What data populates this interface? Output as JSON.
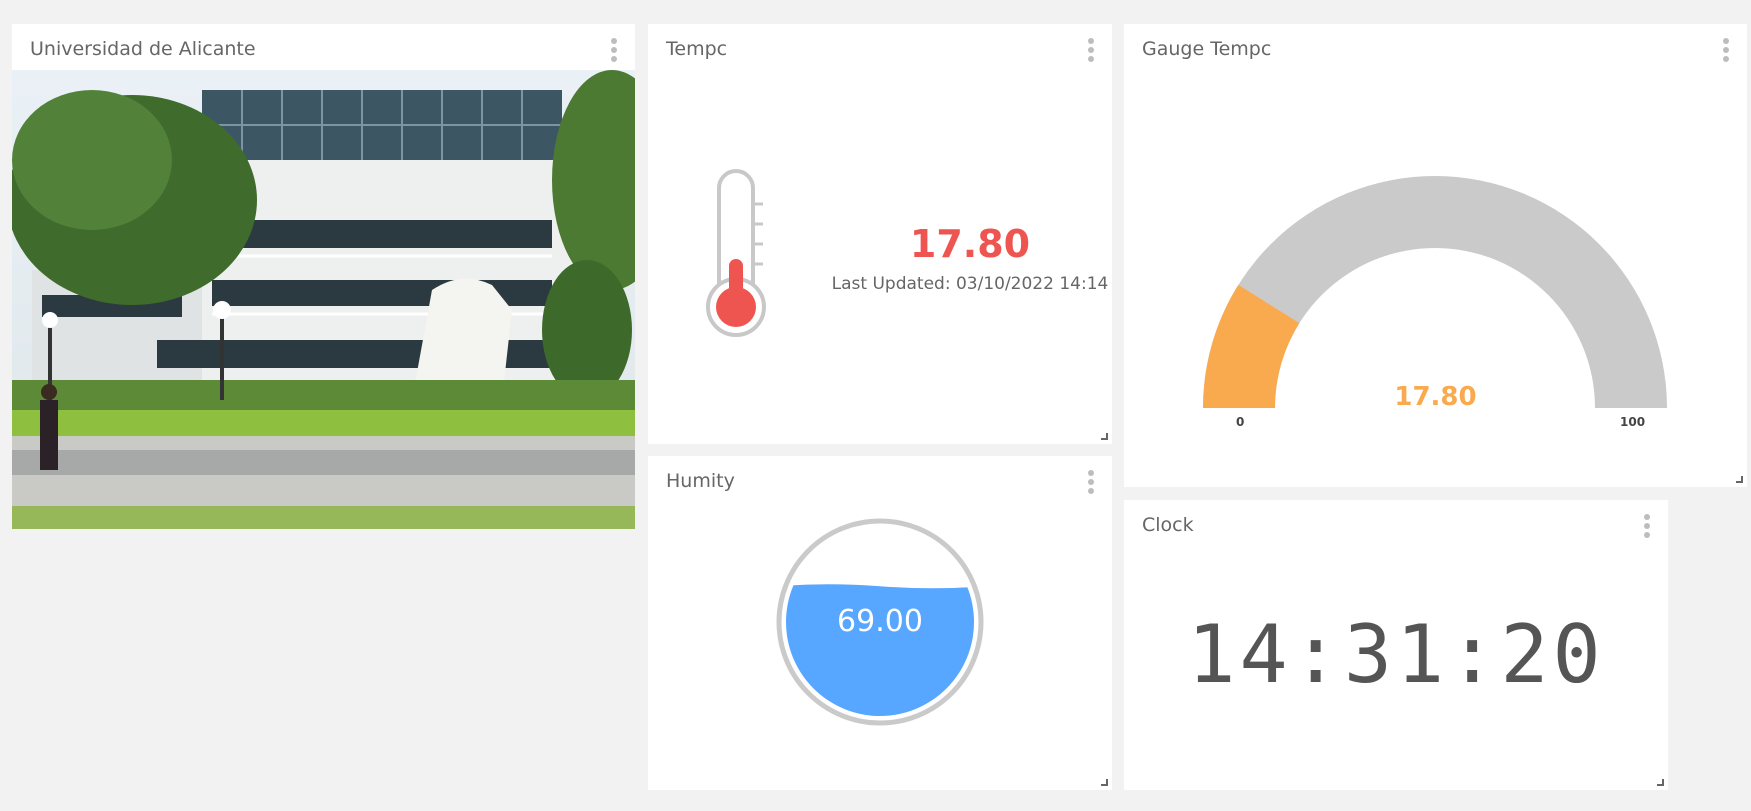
{
  "widgets": {
    "image": {
      "title": "Universidad de Alicante"
    },
    "temperature": {
      "title": "Tempc",
      "value": "17.80",
      "last_updated": "Last Updated: 03/10/2022 14:14",
      "icon": "thermometer-icon",
      "color": "#ee5450"
    },
    "humidity": {
      "title": "Humity",
      "value": "69.00",
      "fill_level": 0.69,
      "color": "#57a6ff"
    },
    "gauge": {
      "title": "Gauge Tempc",
      "value": "17.80",
      "min": "0",
      "max": "100",
      "fraction": 0.178,
      "fill_color": "#f9aa4f",
      "track_color": "#cacaca"
    },
    "clock": {
      "title": "Clock",
      "time": "14:31:20"
    }
  },
  "icons": {
    "menu": "kebab-menu-icon",
    "resize": "resize-handle-icon"
  }
}
